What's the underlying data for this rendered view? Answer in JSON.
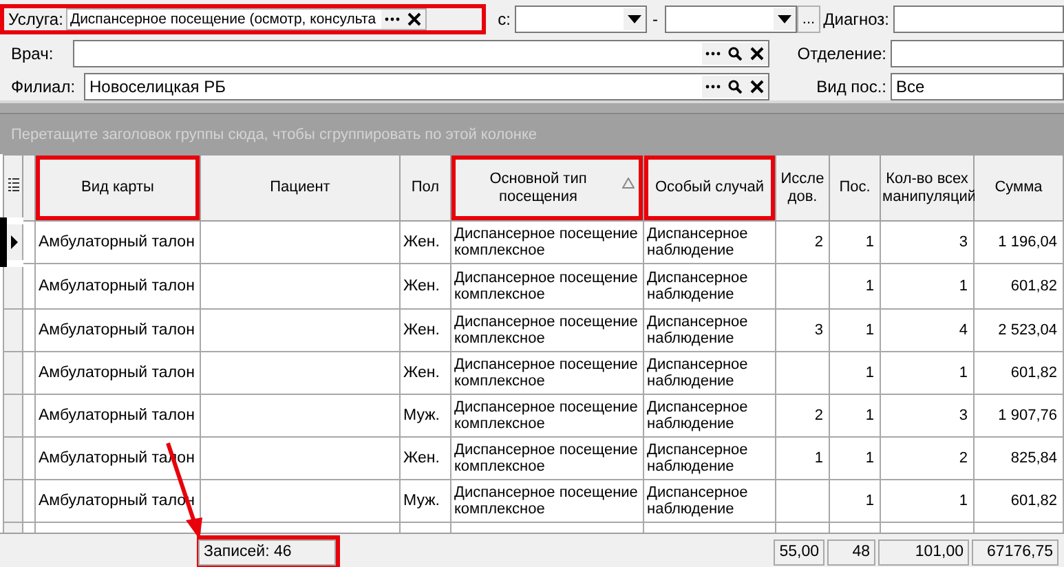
{
  "filters": {
    "service": {
      "label": "Услуга:",
      "value": "Диспансерное посещение (осмотр, консульта",
      "highlighted": true
    },
    "date_from": {
      "label": "с:"
    },
    "date_separator": "-",
    "period_button": "...",
    "diagnosis": {
      "label": "Диагноз:"
    },
    "doctor": {
      "label": "Врач:"
    },
    "department": {
      "label": "Отделение:"
    },
    "branch": {
      "label": "Филиал:",
      "value": "Новоселицкая РБ"
    },
    "visit_type": {
      "label": "Вид пос.:",
      "value": "Все"
    }
  },
  "group_panel": {
    "hint": "Перетащите заголовок группы сюда, чтобы сгруппировать по этой колонке"
  },
  "columns": [
    {
      "label": "Вид карты",
      "highlighted": true,
      "sorted": false,
      "kind": "text"
    },
    {
      "label": "Пациент",
      "highlighted": false,
      "sorted": false,
      "kind": "text"
    },
    {
      "label": "Пол",
      "highlighted": false,
      "sorted": false,
      "kind": "text"
    },
    {
      "label": "Основной тип посещения",
      "highlighted": true,
      "sorted": true,
      "kind": "text"
    },
    {
      "label": "Особый случай",
      "highlighted": true,
      "sorted": false,
      "kind": "text"
    },
    {
      "label": "Иссле дов.",
      "highlighted": false,
      "sorted": false,
      "kind": "number"
    },
    {
      "label": "Пос.",
      "highlighted": false,
      "sorted": false,
      "kind": "number"
    },
    {
      "label": "Кол-во всех манипуляций",
      "highlighted": false,
      "sorted": false,
      "kind": "number"
    },
    {
      "label": "Сумма",
      "highlighted": false,
      "sorted": false,
      "kind": "number"
    }
  ],
  "rows": [
    {
      "current": true,
      "cells": [
        "Амбулаторный талон",
        null,
        "Жен.",
        "Диспансерное посещение комплексное",
        "Диспансерное наблюдение",
        "2",
        "1",
        "3",
        "1 196,04"
      ]
    },
    {
      "current": false,
      "cells": [
        "Амбулаторный талон",
        null,
        "Жен.",
        "Диспансерное посещение комплексное",
        "Диспансерное наблюдение",
        null,
        "1",
        "1",
        "601,82"
      ]
    },
    {
      "current": false,
      "cells": [
        "Амбулаторный талон",
        null,
        "Жен.",
        "Диспансерное посещение комплексное",
        "Диспансерное наблюдение",
        "3",
        "1",
        "4",
        "2 523,04"
      ]
    },
    {
      "current": false,
      "cells": [
        "Амбулаторный талон",
        null,
        "Жен.",
        "Диспансерное посещение комплексное",
        "Диспансерное наблюдение",
        null,
        "1",
        "1",
        "601,82"
      ]
    },
    {
      "current": false,
      "cells": [
        "Амбулаторный талон",
        null,
        "Муж.",
        "Диспансерное посещение комплексное",
        "Диспансерное наблюдение",
        "2",
        "1",
        "3",
        "1 907,76"
      ]
    },
    {
      "current": false,
      "cells": [
        "Амбулаторный талон",
        null,
        "Жен.",
        "Диспансерное посещение комплексное",
        "Диспансерное наблюдение",
        "1",
        "1",
        "2",
        "825,84"
      ]
    },
    {
      "current": false,
      "cells": [
        "Амбулаторный талон",
        null,
        "Муж.",
        "Диспансерное посещение комплексное",
        "Диспансерное наблюдение",
        null,
        "1",
        "1",
        "601,82"
      ]
    }
  ],
  "footer": {
    "record_count": {
      "text": "Записей: 46",
      "highlighted": true
    },
    "totals": [
      "55,00",
      "48",
      "101,00",
      "67176,75"
    ]
  }
}
